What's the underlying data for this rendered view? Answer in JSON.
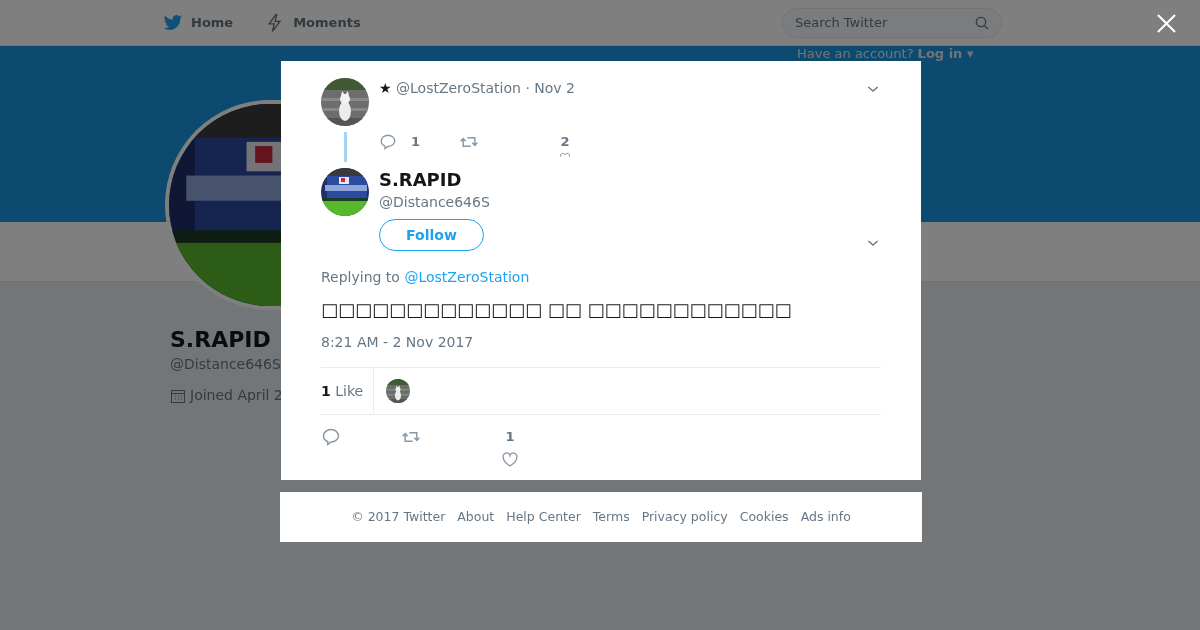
{
  "nav": {
    "items": [
      {
        "label": "Home"
      },
      {
        "label": "Moments"
      }
    ],
    "search": {
      "placeholder": "Search Twitter"
    },
    "login_prompt": "Have an account?",
    "login_link": "Log in ▾"
  },
  "profile": {
    "name": "S.RAPID",
    "handle": "@Distance646S",
    "joined": "Joined April 2"
  },
  "modal": {
    "parent_tweet": {
      "star": "★",
      "handle": "@LostZeroStation",
      "date": "· Nov 2",
      "replies": "1",
      "likes": "2"
    },
    "tweet": {
      "name": "S.RAPID",
      "handle": "@Distance646S",
      "follow": "Follow",
      "replying_label": "Replying to",
      "replying_to": "@LostZeroStation",
      "text": "□□□□□□□□□□□□□ □□ □□□□□□□□□□□□",
      "timestamp": "8:21 AM - 2 Nov 2017",
      "like_count": "1",
      "like_label": "Like",
      "likes": "1"
    }
  },
  "footer": [
    "© 2017 Twitter",
    "About",
    "Help Center",
    "Terms",
    "Privacy policy",
    "Cookies",
    "Ads info"
  ]
}
